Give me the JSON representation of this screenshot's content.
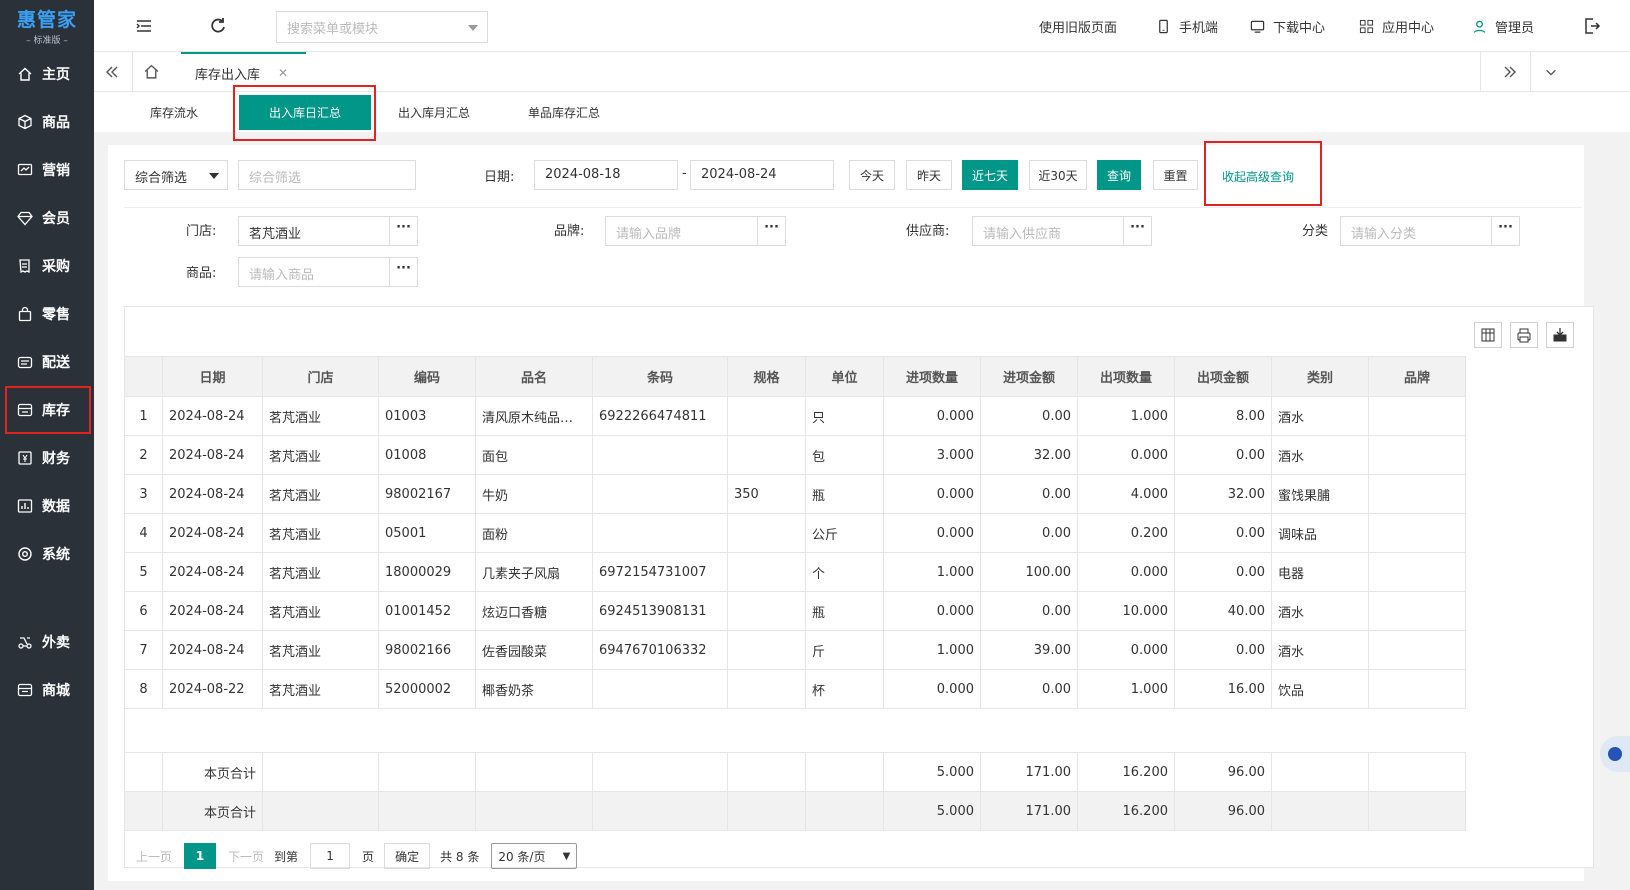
{
  "logo": {
    "name": "惠管家",
    "edition": "– 标准版 –"
  },
  "sidebar": {
    "items": [
      {
        "label": "主页",
        "icon": "home-icon"
      },
      {
        "label": "商品",
        "icon": "cube-icon"
      },
      {
        "label": "营销",
        "icon": "trend-icon"
      },
      {
        "label": "会员",
        "icon": "diamond-icon"
      },
      {
        "label": "采购",
        "icon": "receipt-icon"
      },
      {
        "label": "零售",
        "icon": "bag-icon"
      },
      {
        "label": "配送",
        "icon": "truck-icon"
      },
      {
        "label": "库存",
        "icon": "inventory-icon"
      },
      {
        "label": "财务",
        "icon": "finance-icon"
      },
      {
        "label": "数据",
        "icon": "chart-icon"
      },
      {
        "label": "系统",
        "icon": "gear-icon"
      },
      {
        "label": "外卖",
        "icon": "delivery-icon"
      },
      {
        "label": "商城",
        "icon": "store-icon"
      }
    ],
    "active_index": 7
  },
  "topbar": {
    "search_placeholder": "搜索菜单或模块",
    "old_version": "使用旧版页面",
    "mobile": "手机端",
    "download": "下载中心",
    "apps": "应用中心",
    "user": "管理员"
  },
  "tabs": {
    "current": "库存出入库"
  },
  "subtabs": [
    "库存流水",
    "出入库日汇总",
    "出入库月汇总",
    "单品库存汇总"
  ],
  "filters": {
    "combo_select": "综合筛选",
    "combo_placeholder": "综合筛选",
    "date_label": "日期:",
    "date_from": "2024-08-18",
    "date_sep": "-",
    "date_to": "2024-08-24",
    "btn_today": "今天",
    "btn_yesterday": "昨天",
    "btn_7days": "近七天",
    "btn_30days": "近30天",
    "btn_query": "查询",
    "btn_reset": "重置",
    "collapse_link": "收起高级查询",
    "store_label": "门店:",
    "store_value": "茗芃酒业",
    "brand_label": "品牌:",
    "brand_placeholder": "请输入品牌",
    "supplier_label": "供应商:",
    "supplier_placeholder": "请输入供应商",
    "category_label": "分类",
    "category_placeholder": "请输入分类",
    "product_label": "商品:",
    "product_placeholder": "请输入商品"
  },
  "table": {
    "headers": [
      "日期",
      "门店",
      "编码",
      "品名",
      "条码",
      "规格",
      "单位",
      "进项数量",
      "进项金额",
      "出项数量",
      "出项金额",
      "类别",
      "品牌"
    ],
    "rows": [
      [
        "1",
        "2024-08-24",
        "茗芃酒业",
        "01003",
        "清风原木纯品…",
        "6922266474811",
        "",
        "只",
        "0.000",
        "0.00",
        "1.000",
        "8.00",
        "酒水",
        ""
      ],
      [
        "2",
        "2024-08-24",
        "茗芃酒业",
        "01008",
        "面包",
        "",
        "",
        "包",
        "3.000",
        "32.00",
        "0.000",
        "0.00",
        "酒水",
        ""
      ],
      [
        "3",
        "2024-08-24",
        "茗芃酒业",
        "98002167",
        "牛奶",
        "",
        "350",
        "瓶",
        "0.000",
        "0.00",
        "4.000",
        "32.00",
        "蜜饯果脯",
        ""
      ],
      [
        "4",
        "2024-08-24",
        "茗芃酒业",
        "05001",
        "面粉",
        "",
        "",
        "公斤",
        "0.000",
        "0.00",
        "0.200",
        "0.00",
        "调味品",
        ""
      ],
      [
        "5",
        "2024-08-24",
        "茗芃酒业",
        "18000029",
        "几素夹子风扇",
        "6972154731007",
        "",
        "个",
        "1.000",
        "100.00",
        "0.000",
        "0.00",
        "电器",
        ""
      ],
      [
        "6",
        "2024-08-24",
        "茗芃酒业",
        "01001452",
        "炫迈口香糖",
        "6924513908131",
        "",
        "瓶",
        "0.000",
        "0.00",
        "10.000",
        "40.00",
        "酒水",
        ""
      ],
      [
        "7",
        "2024-08-24",
        "茗芃酒业",
        "98002166",
        "佐香园酸菜",
        "6947670106332",
        "",
        "斤",
        "1.000",
        "39.00",
        "0.000",
        "0.00",
        "酒水",
        ""
      ],
      [
        "8",
        "2024-08-22",
        "茗芃酒业",
        "52000002",
        "椰香奶茶",
        "",
        "",
        "杯",
        "0.000",
        "0.00",
        "1.000",
        "16.00",
        "饮品",
        ""
      ]
    ],
    "summary_label": "本页合计",
    "summary": {
      "in_qty": "5.000",
      "in_amt": "171.00",
      "out_qty": "16.200",
      "out_amt": "96.00"
    }
  },
  "pager": {
    "prev": "上一页",
    "page": "1",
    "next": "下一页",
    "goto": "到第",
    "goto_value": "1",
    "page_unit": "页",
    "confirm": "确定",
    "total": "共 8 条",
    "page_size": "20 条/页"
  },
  "colors": {
    "accent": "#009688",
    "sidebar": "#2a3139",
    "highlight": "#e02424"
  }
}
